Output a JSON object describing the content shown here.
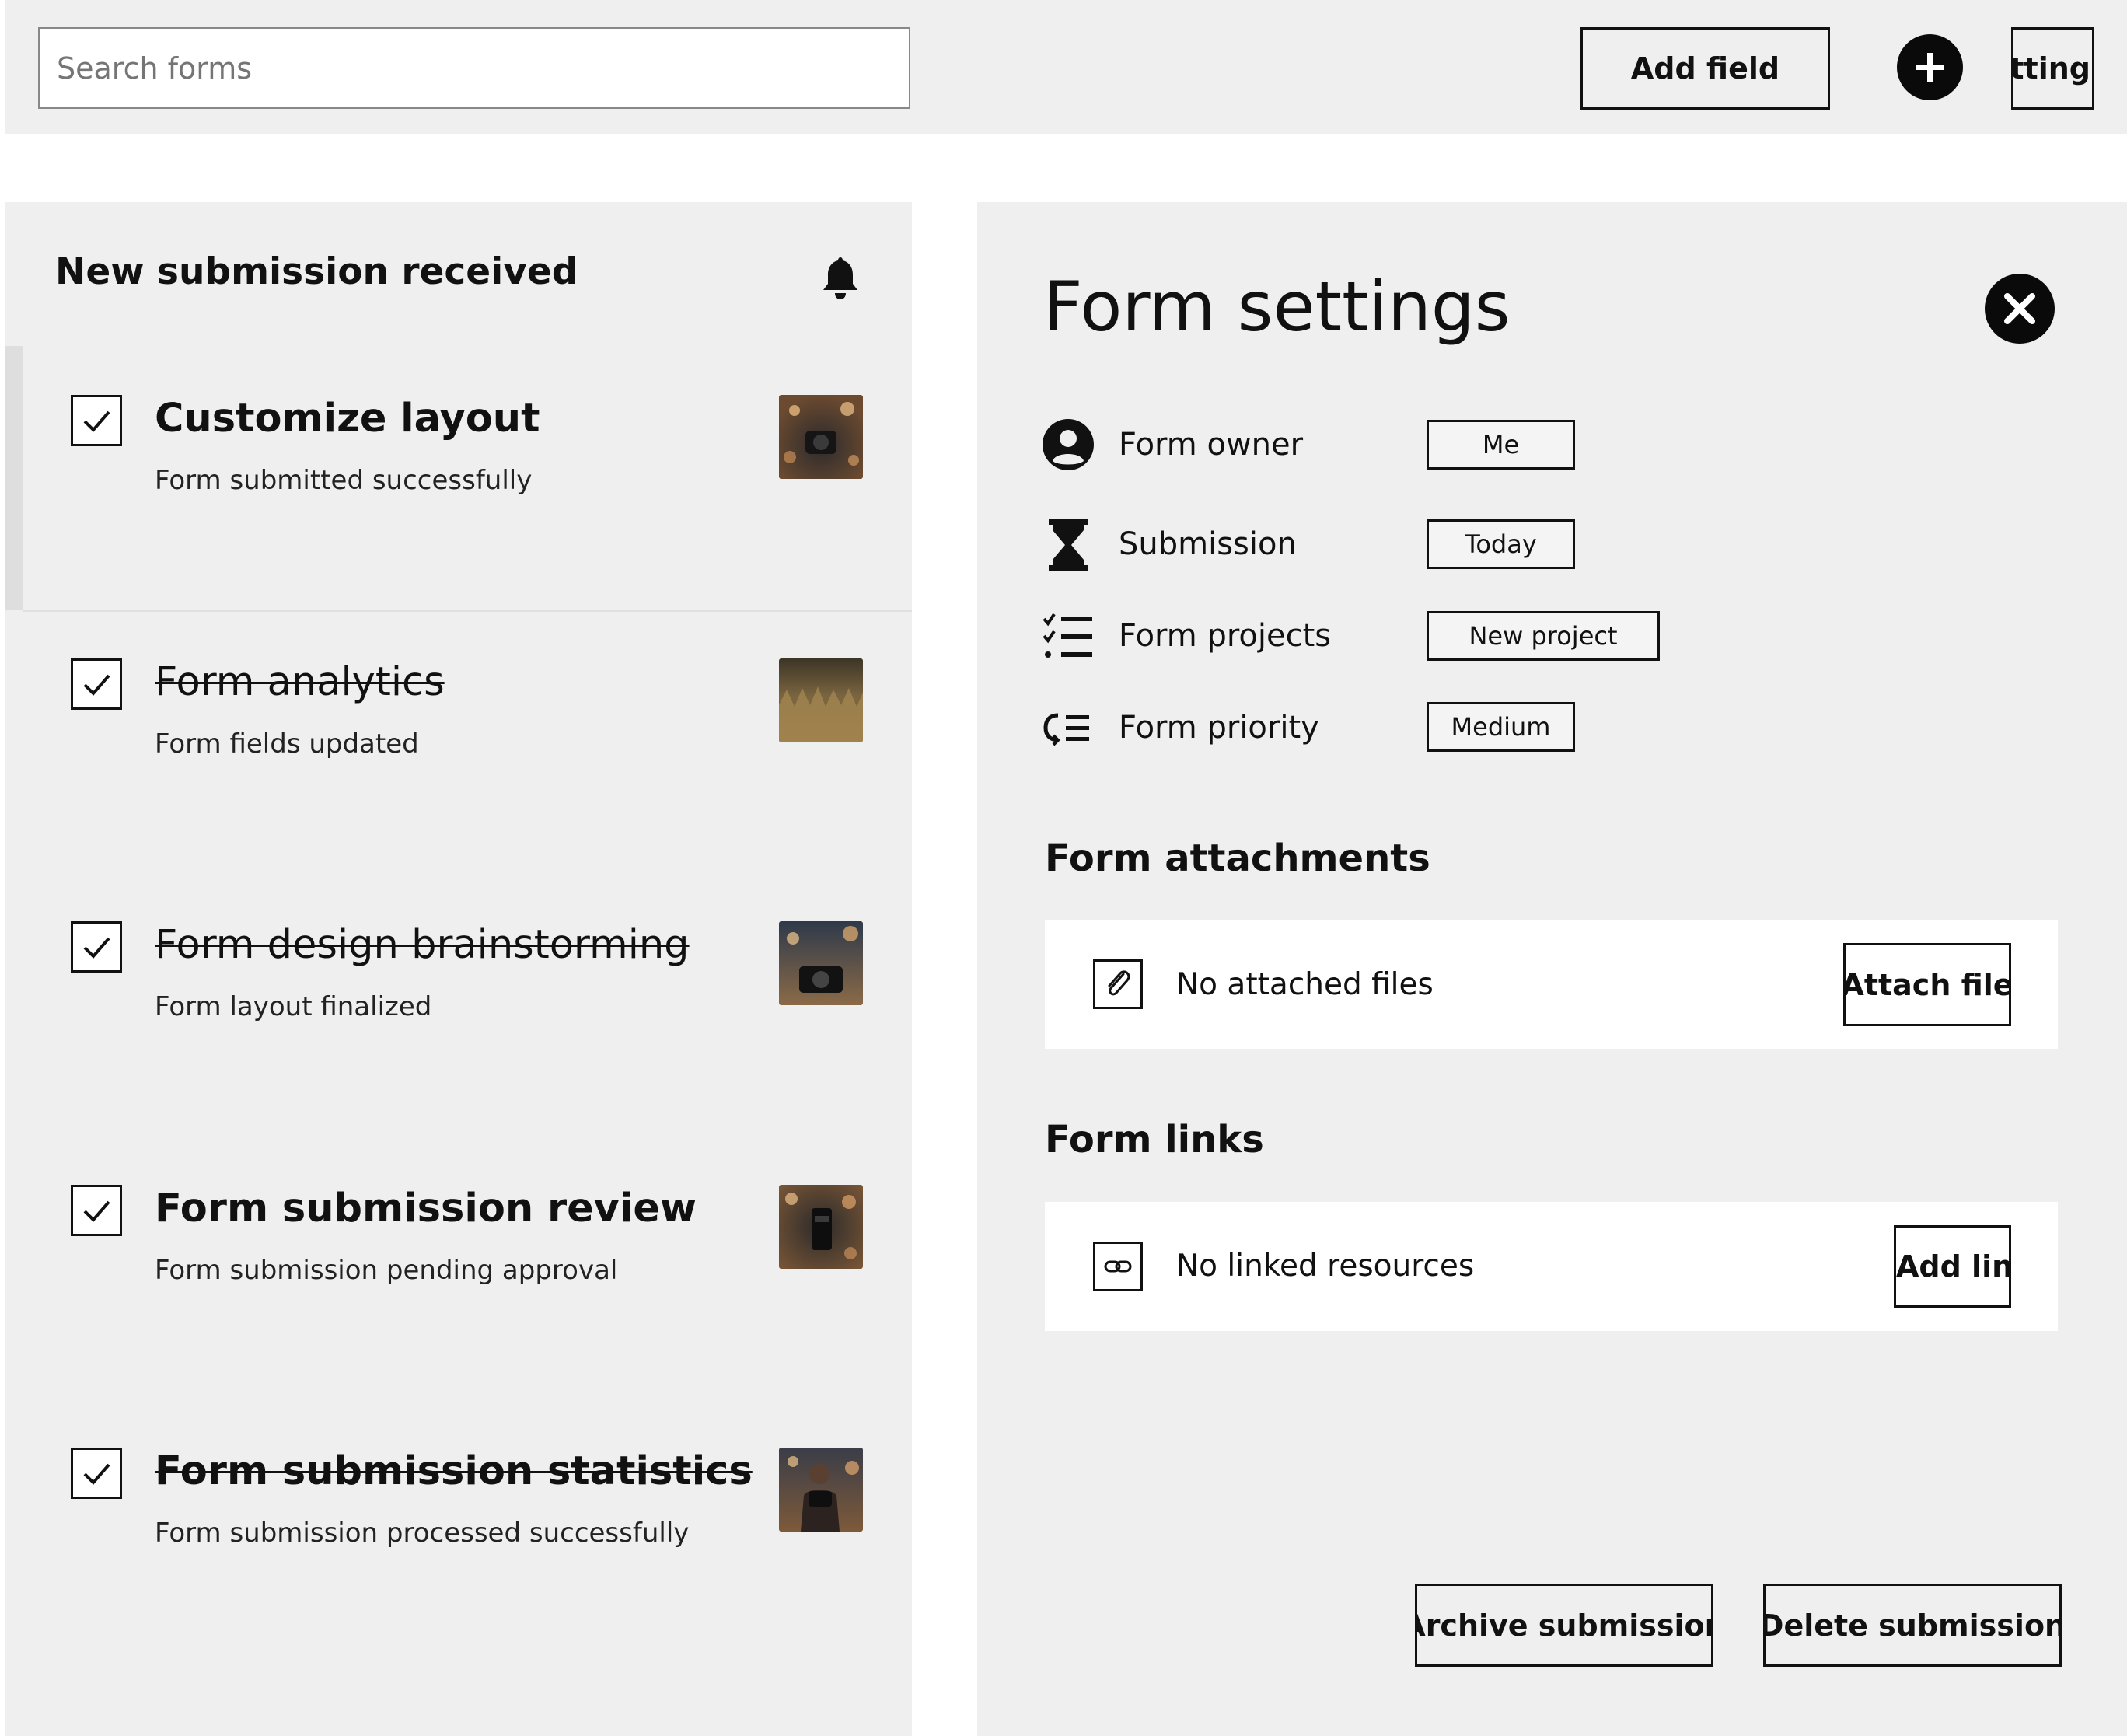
{
  "search": {
    "placeholder": "Search forms"
  },
  "toolbar": {
    "add_field_label": "Add field",
    "settings_label": "etting"
  },
  "notifications": {
    "title": "New submission received",
    "items": [
      {
        "title": "Customize layout",
        "subtitle": "Form submitted successfully",
        "completed": false
      },
      {
        "title": "Form analytics",
        "subtitle": "Form fields updated",
        "completed": true
      },
      {
        "title": "Form design brainstorming",
        "subtitle": "Form layout finalized",
        "completed": true
      },
      {
        "title": "Form submission review",
        "subtitle": "Form submission pending approval",
        "completed": false
      },
      {
        "title": "Form submission statistics",
        "subtitle": "Form submission processed successfully",
        "completed": true
      }
    ]
  },
  "panel": {
    "title": "Form settings",
    "properties": [
      {
        "label": "Form owner",
        "value": "Me",
        "icon": "person-circle-icon"
      },
      {
        "label": "Submission",
        "value": "Today",
        "icon": "hourglass-icon"
      },
      {
        "label": "Form projects",
        "value": "New project",
        "icon": "checklist-icon"
      },
      {
        "label": "Form priority",
        "value": "Medium",
        "icon": "priority-list-icon"
      }
    ],
    "attachments": {
      "title": "Form attachments",
      "empty_text": "No attached files",
      "button": "Attach file"
    },
    "links": {
      "title": "Form links",
      "empty_text": "No linked resources",
      "button": "Add link"
    },
    "archive_button": "Archive submission",
    "delete_button": "Delete submission"
  }
}
